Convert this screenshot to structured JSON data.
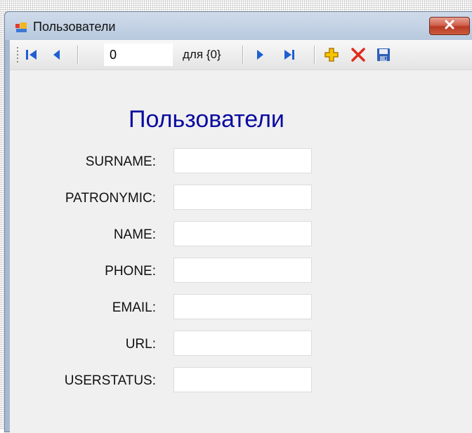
{
  "window": {
    "title": "Пользователи",
    "icon": "form-icon",
    "close_icon": "close-icon"
  },
  "toolbar": {
    "position_value": "0",
    "count_label": "для {0}",
    "buttons": [
      {
        "name": "move-first-button",
        "icon": "move-first-icon"
      },
      {
        "name": "move-previous-button",
        "icon": "move-previous-icon"
      },
      {
        "name": "move-next-button",
        "icon": "move-next-icon"
      },
      {
        "name": "move-last-button",
        "icon": "move-last-icon"
      },
      {
        "name": "add-new-button",
        "icon": "add-icon"
      },
      {
        "name": "delete-button",
        "icon": "delete-icon"
      },
      {
        "name": "save-button",
        "icon": "save-icon"
      }
    ]
  },
  "form": {
    "heading": "Пользователи",
    "fields": [
      {
        "label": "SURNAME:",
        "value": ""
      },
      {
        "label": "PATRONYMIC:",
        "value": ""
      },
      {
        "label": "NAME:",
        "value": ""
      },
      {
        "label": "PHONE:",
        "value": ""
      },
      {
        "label": "EMAIL:",
        "value": ""
      },
      {
        "label": "URL:",
        "value": ""
      },
      {
        "label": "USERSTATUS:",
        "value": ""
      }
    ]
  },
  "colors": {
    "heading": "#0a0aa0",
    "nav_arrows": "#1f5fd0",
    "add_icon": "#e8b400",
    "delete_icon": "#e02a1a",
    "close_button": "#c4503a"
  }
}
